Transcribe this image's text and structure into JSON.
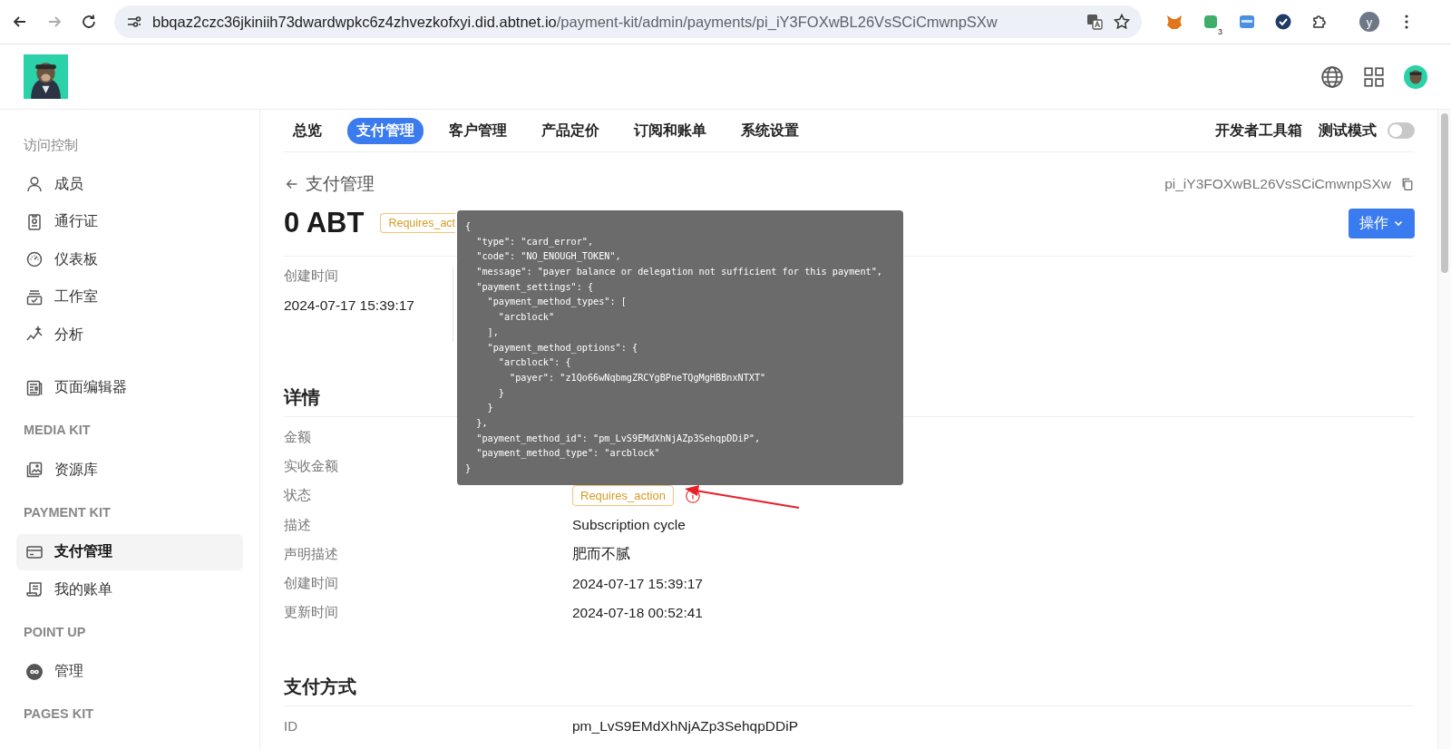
{
  "browser": {
    "url_host": "bbqaz2czc36jkiniih73dwardwpkc6z4zhvezkofxyi.did.abtnet.io",
    "url_path": "/payment-kit/admin/payments/pi_iY3FOXwBL26VsSCiCmwnpSXw",
    "extension_badge": "3",
    "profile_initial": "y"
  },
  "sidebar": {
    "sections": [
      {
        "items": [
          {
            "label": "成员",
            "selected": false
          },
          {
            "label": "通行证",
            "selected": false
          },
          {
            "label": "仪表板",
            "selected": false
          },
          {
            "label": "工作室",
            "selected": false
          },
          {
            "label": "分析",
            "selected": false
          }
        ],
        "title": "访问控制"
      },
      {
        "items": [
          {
            "label": "页面编辑器",
            "selected": false
          }
        ]
      },
      {
        "title": "MEDIA KIT",
        "items": [
          {
            "label": "资源库",
            "selected": false
          }
        ]
      },
      {
        "title": "PAYMENT KIT",
        "items": [
          {
            "label": "支付管理",
            "selected": true
          },
          {
            "label": "我的账单",
            "selected": false
          }
        ]
      },
      {
        "title": "POINT UP",
        "items": [
          {
            "label": "管理",
            "selected": false
          }
        ]
      },
      {
        "title": "PAGES KIT"
      }
    ]
  },
  "nav": {
    "tabs": [
      {
        "label": "总览",
        "selected": false
      },
      {
        "label": "支付管理",
        "selected": true
      },
      {
        "label": "客户管理",
        "selected": false
      },
      {
        "label": "产品定价",
        "selected": false
      },
      {
        "label": "订阅和账单",
        "selected": false
      },
      {
        "label": "系统设置",
        "selected": false
      }
    ],
    "dev_tools": "开发者工具箱",
    "test_mode": {
      "label": "测试模式",
      "on": false
    }
  },
  "page": {
    "back_label": "支付管理",
    "payment_id": "pi_iY3FOXwBL26VsSCiCmwnpSXw",
    "amount": "0 ABT",
    "status_badge": "Requires_act",
    "action_button": "操作",
    "summary": [
      {
        "label": "创建时间",
        "value": "2024-07-17 15:39:17"
      }
    ],
    "details_title": "详情",
    "details": [
      {
        "label": "金额",
        "kind": "text"
      },
      {
        "label": "实收金额",
        "kind": "text"
      },
      {
        "label": "状态",
        "kind": "badge",
        "value": "Requires_action"
      },
      {
        "label": "描述",
        "kind": "text",
        "value": "Subscription cycle"
      },
      {
        "label": "声明描述",
        "kind": "text",
        "value": "肥而不腻"
      },
      {
        "label": "创建时间",
        "kind": "text",
        "value": "2024-07-17 15:39:17"
      },
      {
        "label": "更新时间",
        "kind": "text",
        "value": "2024-07-18 00:52:41"
      }
    ],
    "method_title": "支付方式",
    "method_rows": [
      {
        "label": "ID",
        "value": "pm_LvS9EMdXhNjAZp3SehqpDDiP"
      }
    ]
  },
  "tooltip": {
    "lines": [
      "{",
      "  \"type\": \"card_error\",",
      "  \"code\": \"NO_ENOUGH_TOKEN\",",
      "  \"message\": \"payer balance or delegation not sufficient for this payment\",",
      "  \"payment_settings\": {",
      "    \"payment_method_types\": [",
      "      \"arcblock\"",
      "    ],",
      "    \"payment_method_options\": {",
      "      \"arcblock\": {",
      "        \"payer\": \"z1Qo66wNqbmgZRCYgBPneTQgMgHBBnxNTXT\"",
      "      }",
      "    }",
      "  },",
      "  \"payment_method_id\": \"pm_LvS9EMdXhNjAZp3SehqpDDiP\",",
      "  \"payment_method_type\": \"arcblock\"",
      "}"
    ]
  }
}
